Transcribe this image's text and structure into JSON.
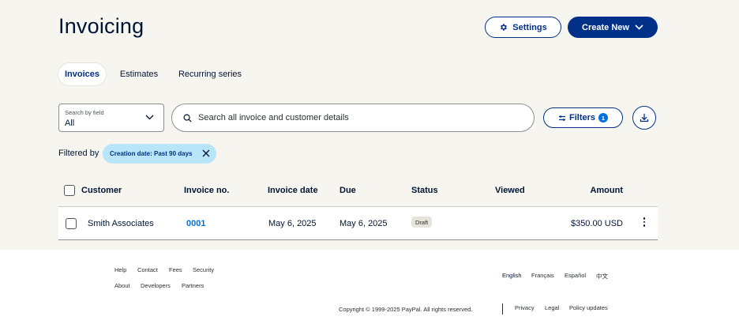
{
  "header": {
    "title": "Invoicing",
    "settings_label": "Settings",
    "create_label": "Create New"
  },
  "tabs": [
    {
      "label": "Invoices",
      "active": true
    },
    {
      "label": "Estimates",
      "active": false
    },
    {
      "label": "Recurring series",
      "active": false
    }
  ],
  "search_field": {
    "label": "Search by field",
    "value": "All"
  },
  "search": {
    "placeholder": "Search all invoice and customer details"
  },
  "filters": {
    "label": "Filters",
    "count": "1"
  },
  "filtered_by": {
    "label": "Filtered by",
    "chip": "Creation date: Past 90 days"
  },
  "table": {
    "columns": [
      "Customer",
      "Invoice no.",
      "Invoice date",
      "Due",
      "Status",
      "Viewed",
      "Amount"
    ],
    "rows": [
      {
        "customer": "Smith Associates",
        "invoice_no": "0001",
        "invoice_date": "May 6, 2025",
        "due": "May 6, 2025",
        "status": "Draft",
        "viewed": "",
        "amount": "$350.00 USD"
      }
    ]
  },
  "footer": {
    "links_row1": [
      "Help",
      "Contact",
      "Fees",
      "Security"
    ],
    "links_row2": [
      "About",
      "Developers",
      "Partners"
    ],
    "languages": [
      "English",
      "Français",
      "Español",
      "中文"
    ],
    "copyright": "Copyright © 1999-2025 PayPal. All rights reserved.",
    "legal_links": [
      "Privacy",
      "Legal",
      "Policy updates"
    ]
  },
  "colors": {
    "brand_navy": "#003087",
    "link_blue": "#0070e0",
    "chip_bg": "#b8e5f8",
    "page_bg": "#f7f5f0"
  }
}
